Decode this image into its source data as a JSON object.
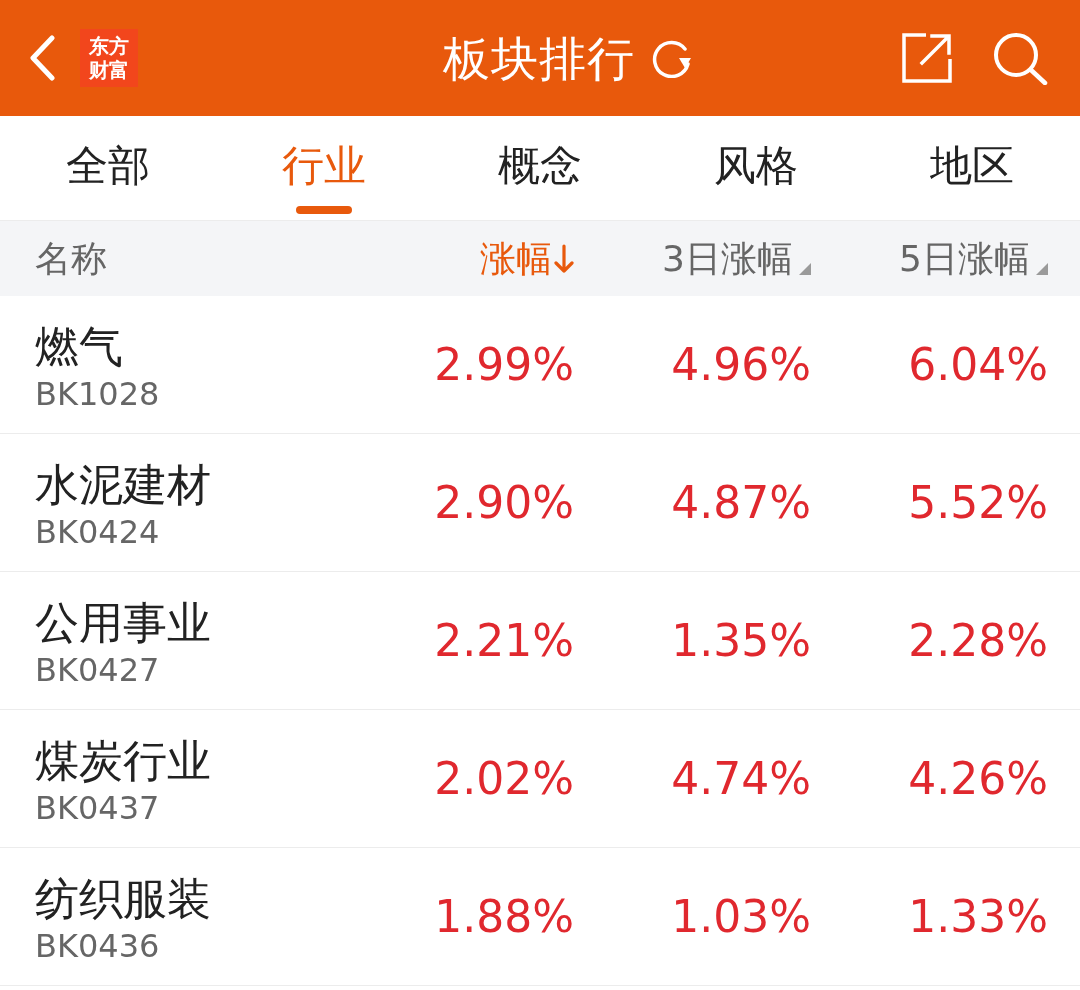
{
  "header": {
    "logo": [
      "东方",
      "财富"
    ],
    "title": "板块排行"
  },
  "tabs": [
    {
      "label": "全部",
      "selected": false
    },
    {
      "label": "行业",
      "selected": true
    },
    {
      "label": "概念",
      "selected": false
    },
    {
      "label": "风格",
      "selected": false
    },
    {
      "label": "地区",
      "selected": false
    }
  ],
  "table": {
    "columns": [
      {
        "label": "名称",
        "selected": false
      },
      {
        "label": "涨幅",
        "selected": true,
        "descending": true
      },
      {
        "label": "3日涨幅",
        "selected": false
      },
      {
        "label": "5日涨幅",
        "selected": false
      }
    ],
    "rows": [
      {
        "name": "燃气",
        "code": "BK1028",
        "values": [
          "2.99%",
          "4.96%",
          "6.04%"
        ]
      },
      {
        "name": "水泥建材",
        "code": "BK0424",
        "values": [
          "2.90%",
          "4.87%",
          "5.52%"
        ]
      },
      {
        "name": "公用事业",
        "code": "BK0427",
        "values": [
          "2.21%",
          "1.35%",
          "2.28%"
        ]
      },
      {
        "name": "煤炭行业",
        "code": "BK0437",
        "values": [
          "2.02%",
          "4.74%",
          "4.26%"
        ]
      },
      {
        "name": "纺织服装",
        "code": "BK0436",
        "values": [
          "1.88%",
          "1.03%",
          "1.33%"
        ]
      }
    ]
  }
}
